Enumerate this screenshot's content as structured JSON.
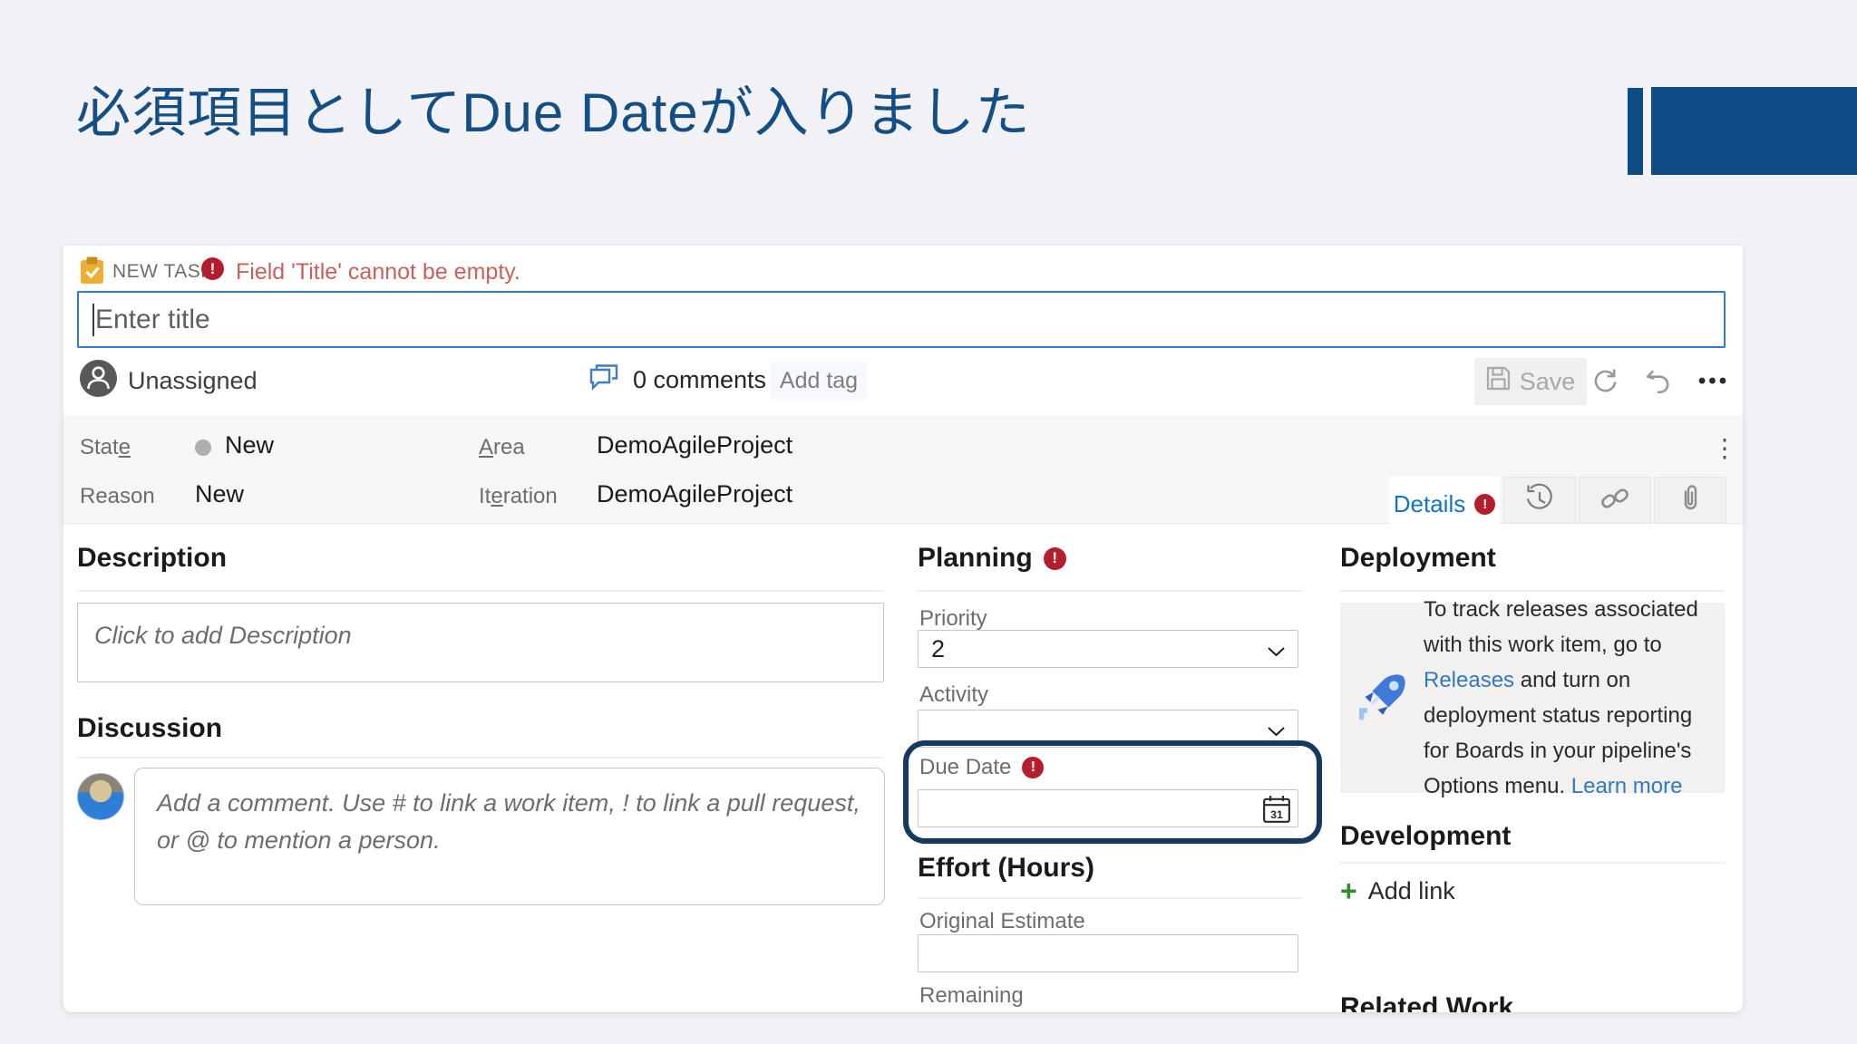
{
  "slide": {
    "title": "必須項目としてDue Dateが入りました"
  },
  "workitem": {
    "type": "NEW TASK",
    "validation_error": "Field 'Title' cannot be empty.",
    "title_placeholder": "Enter title",
    "assignee": "Unassigned",
    "comments_count": "0 comments",
    "add_tag": "Add tag",
    "save": "Save"
  },
  "fields": {
    "state": {
      "label_pre": "Stat",
      "label_key": "e",
      "value": "New"
    },
    "reason": {
      "label": "Reason",
      "value": "New"
    },
    "area": {
      "label_key": "A",
      "label_post": "rea",
      "value": "DemoAgileProject"
    },
    "iteration": {
      "label_pre": "It",
      "label_key": "e",
      "label_post": "ration",
      "value": "DemoAgileProject"
    }
  },
  "tabs": {
    "details": "Details"
  },
  "description": {
    "heading": "Description",
    "placeholder": "Click to add Description"
  },
  "discussion": {
    "heading": "Discussion",
    "placeholder": "Add a comment. Use # to link a work item, ! to link a pull request, or @ to mention a person."
  },
  "planning": {
    "heading": "Planning",
    "priority_label": "Priority",
    "priority_value": "2",
    "activity_label": "Activity",
    "activity_value": "",
    "due_date_label": "Due Date",
    "due_date_value": "",
    "calendar_day": "31"
  },
  "effort": {
    "heading": "Effort (Hours)",
    "original_estimate_label": "Original Estimate",
    "remaining_label": "Remaining"
  },
  "deployment": {
    "heading": "Deployment",
    "text_1": "To track releases associated with this work item, go to ",
    "releases_link": "Releases",
    "text_2": " and turn on deployment status reporting for Boards in your pipeline's Options menu. ",
    "learn_more_link": "Learn more"
  },
  "development": {
    "heading": "Development",
    "add_link": "Add link"
  },
  "related_work": {
    "heading": "Related Work"
  },
  "colors": {
    "accent": "#134F85",
    "error_badge": "#B41D2C",
    "link": "#3279BE",
    "focus_border": "#2E7CD6"
  }
}
